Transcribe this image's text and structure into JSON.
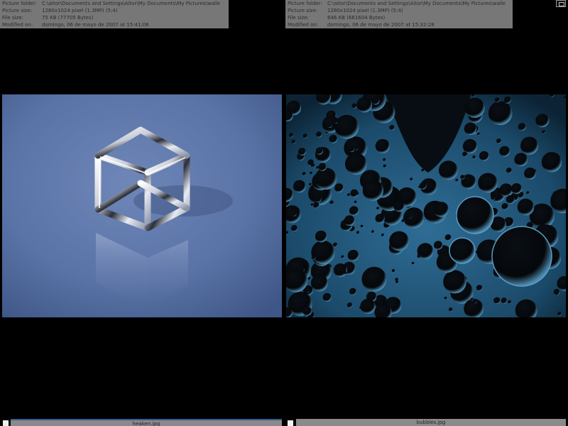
{
  "panels": {
    "left": {
      "info": [
        {
          "label": "Picture folder:",
          "value": "C:\\aitor\\Documents and Settings\\Aitor\\My Documents\\My Pictures\\walle"
        },
        {
          "label": "Picture size:",
          "value": "1280x1024 pixel (1.3MP) (5:4)"
        },
        {
          "label": "File size:",
          "value": "75 KB (77705 Bytes)"
        },
        {
          "label": "Modified on:",
          "value": "domingo, 06 de mayo de 2007 at 15:41:06"
        }
      ],
      "caption": "heaken.jpg"
    },
    "right": {
      "info": [
        {
          "label": "Picture folder:",
          "value": "C:\\aitor\\Documents and Settings\\Aitor\\My Documents\\My Pictures\\walle"
        },
        {
          "label": "Picture size:",
          "value": "1280x1024 pixel (1.3MP) (5:4)"
        },
        {
          "label": "File size:",
          "value": "646 KB (661604 Bytes)"
        },
        {
          "label": "Modified on:",
          "value": "domingo, 06 de mayo de 2007 at 15:32:28"
        }
      ],
      "caption": "bubbles.jpg"
    }
  },
  "icons": {
    "corner": "window-restore-icon"
  },
  "colors": {
    "background": "#000000",
    "panel": "#777777",
    "cube_bg": "#5a73a6",
    "bubbles_bg": "#1b4a6a"
  }
}
